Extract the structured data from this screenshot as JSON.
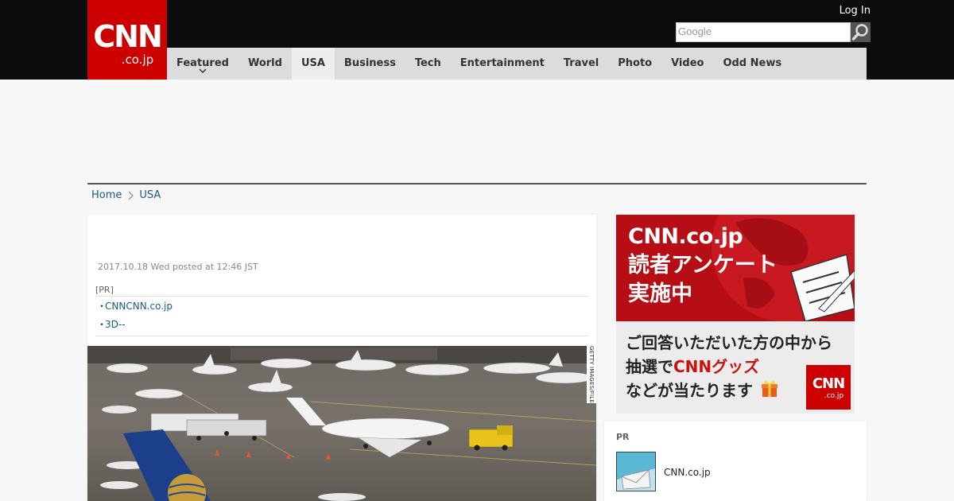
{
  "header": {
    "logo_main": "CNN",
    "logo_sub": ".co.jp",
    "login_label": "Log In",
    "search_placeholder": "Google"
  },
  "nav": {
    "items": [
      {
        "label": "Featured"
      },
      {
        "label": "World"
      },
      {
        "label": "USA"
      },
      {
        "label": "Business"
      },
      {
        "label": "Tech"
      },
      {
        "label": "Entertainment"
      },
      {
        "label": "Travel"
      },
      {
        "label": "Photo"
      },
      {
        "label": "Video"
      },
      {
        "label": "Odd News"
      }
    ],
    "active": "USA"
  },
  "breadcrumb": {
    "home": "Home",
    "section": "USA"
  },
  "article": {
    "posted": "2017.10.18 Wed posted at 12:46 JST",
    "pr_label": "[PR]",
    "pr_links": [
      "CNNCNN.co.jp",
      "3D--"
    ],
    "dot": "・",
    "photo_credit": "GETTY IMAGES/FILE"
  },
  "banner": {
    "line1": "CNN.co.jp",
    "line2": "読者アンケート",
    "line3": "実施中",
    "line4": "ご回答いただいた方の中から",
    "line5_pre": "抽選で",
    "line5_red": "CNNグッズ",
    "line6": "などが当たります",
    "logo_main": "CNN",
    "logo_sub": ".co.jp"
  },
  "sidebar_pr": {
    "label": "PR",
    "item_text": "CNN.co.jp"
  },
  "colors": {
    "brand_red": "#cc0000",
    "header_black": "#0c0c0c",
    "nav_gray": "#dcdcdc",
    "link_blue": "#1a5a8a"
  }
}
